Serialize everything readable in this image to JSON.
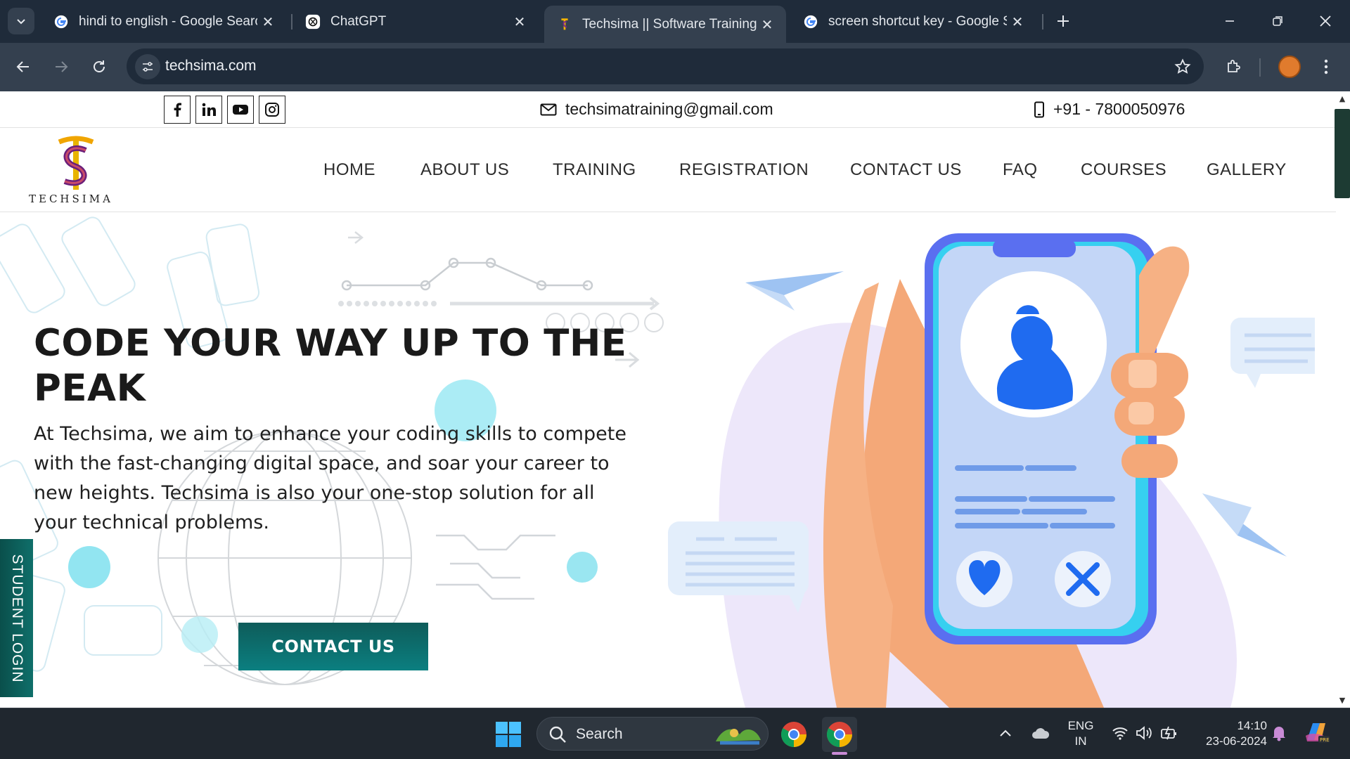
{
  "browser": {
    "tabs": [
      {
        "title": "hindi to english - Google Search",
        "favicon": "google-icon",
        "active": false
      },
      {
        "title": "ChatGPT",
        "favicon": "chatgpt-icon",
        "active": false
      },
      {
        "title": "Techsima || Software Training Institute",
        "favicon": "techsima-icon",
        "active": true
      },
      {
        "title": "screen shortcut key - Google Search",
        "favicon": "google-icon",
        "active": false
      }
    ],
    "url": "techsima.com"
  },
  "topbar": {
    "social": [
      "facebook-icon",
      "linkedin-icon",
      "youtube-icon",
      "instagram-icon"
    ],
    "email": "techsimatraining@gmail.com",
    "phone": "+91 - 7800050976"
  },
  "navbar": {
    "logo_text": "TECHSIMA",
    "items": [
      "HOME",
      "ABOUT US",
      "TRAINING",
      "REGISTRATION",
      "CONTACT US",
      "FAQ",
      "COURSES",
      "GALLERY"
    ]
  },
  "hero": {
    "title": "CODE YOUR WAY UP TO THE PEAK",
    "text": "At Techsima, we aim to enhance your coding skills to compete with the fast-changing digital space, and soar your career to new heights. Techsima is also your one-stop solution for all your technical problems.",
    "cta_label": "CONTACT US",
    "side_tab": "STUDENT LOGIN"
  },
  "taskbar": {
    "search_label": "Search",
    "language_line1": "ENG",
    "language_line2": "IN",
    "time": "14:10",
    "date": "23-06-2024"
  },
  "colors": {
    "accent_teal": "#0b7f80",
    "chrome_dark": "#1f2b3a",
    "chrome_toolbar": "#34404f",
    "taskbar": "#20272f"
  }
}
